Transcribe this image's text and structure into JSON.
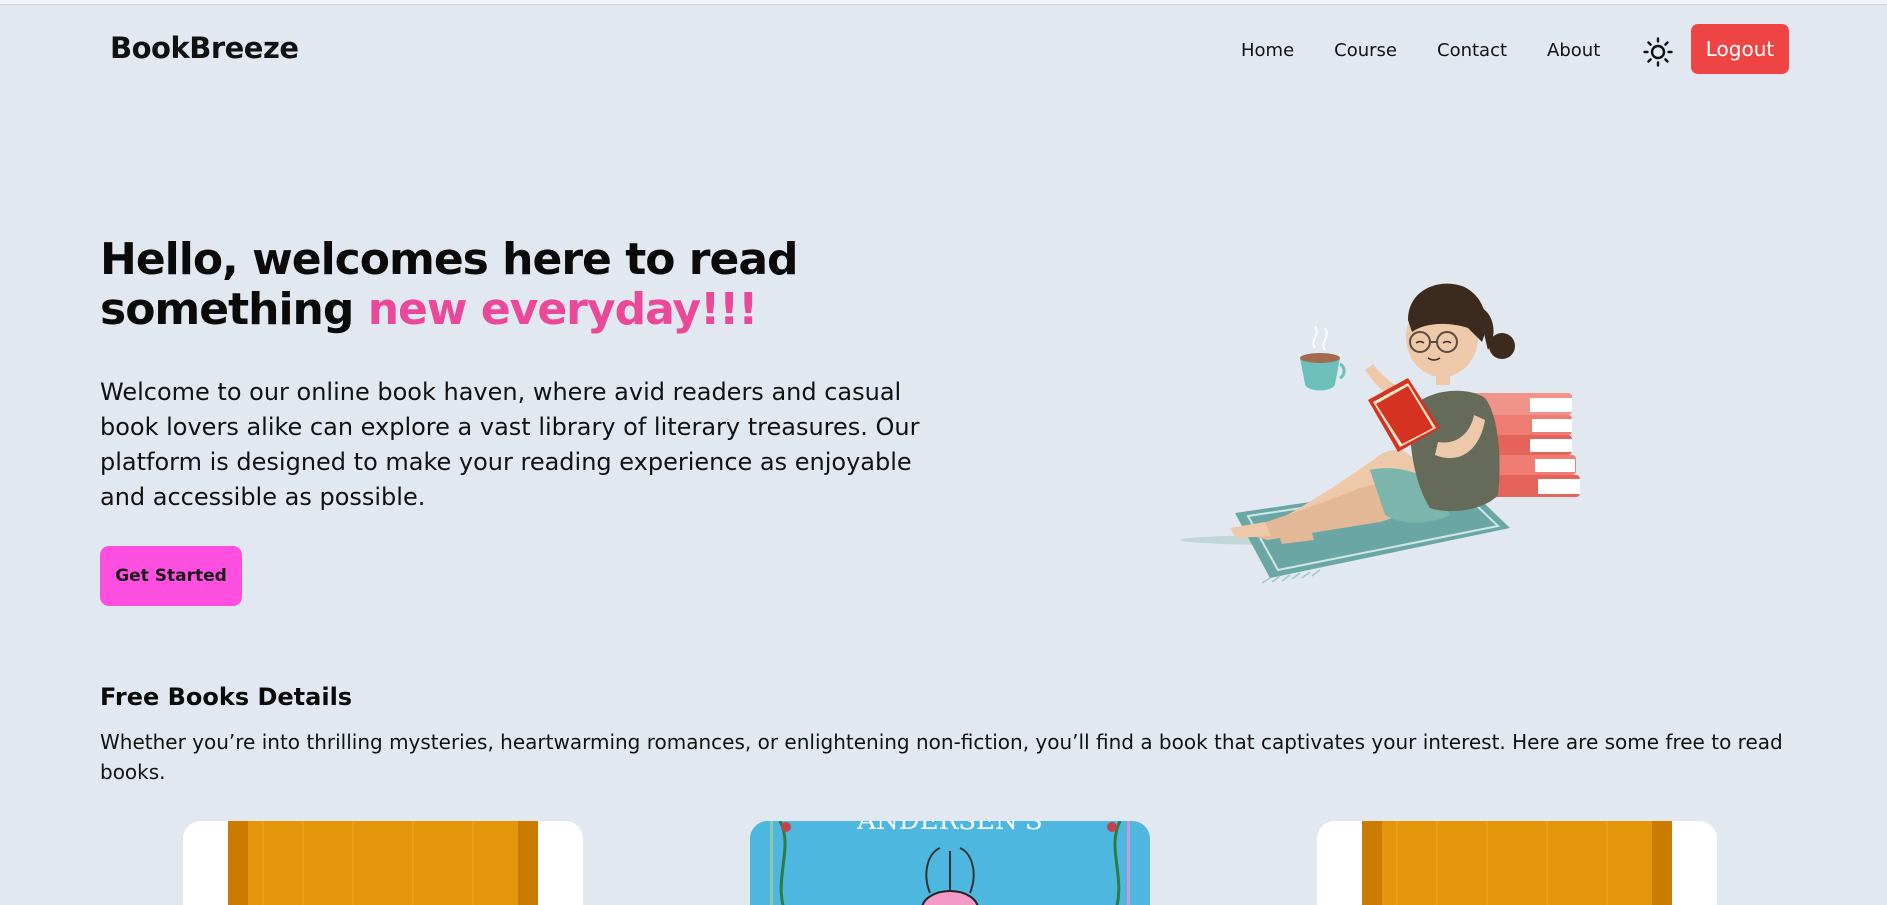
{
  "navbar": {
    "brand": "BookBreeze",
    "links": [
      "Home",
      "Course",
      "Contact",
      "About"
    ],
    "theme_icon": "sun-icon",
    "logout_label": "Logout"
  },
  "hero": {
    "title_line1": "Hello, welcomes here to read",
    "title_line2_prefix": "something ",
    "title_highlight": "new everyday!!!",
    "description": "Welcome to our online book haven, where avid readers and casual book lovers alike can explore a vast library of literary treasures. Our platform is designed to make your reading experience as enjoyable and accessible as possible.",
    "cta_label": "Get Started",
    "illustration": "woman-reading-book-illustration"
  },
  "free_books": {
    "title": "Free Books Details",
    "description": "Whether you’re into thrilling mysteries, heartwarming romances, or enlightening non-fiction, you’ll find a book that captivates your interest. Here are some free to read books.",
    "cards": [
      {
        "cover": "orange-book-cover"
      },
      {
        "cover": "andersen-fairy-tales-cover",
        "cover_text": "ANDERSEN'S"
      },
      {
        "cover": "orange-book-cover"
      }
    ]
  },
  "colors": {
    "background": "#e2e8f0",
    "accent_pink": "#ec4899",
    "cta_pink": "#ff4fe0",
    "logout_red": "#ef4444"
  }
}
